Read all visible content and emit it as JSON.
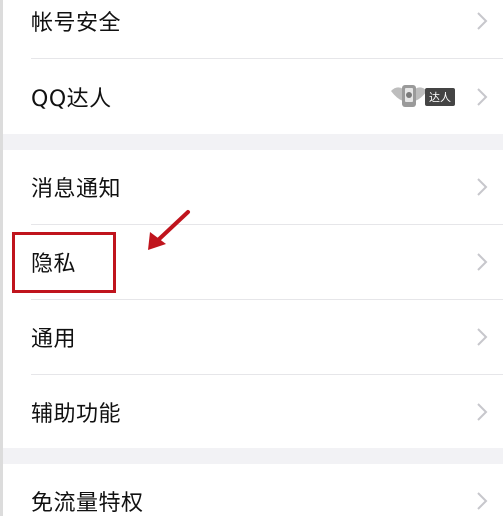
{
  "settings": {
    "items": [
      {
        "label": "帐号安全"
      },
      {
        "label": "QQ达人"
      },
      {
        "label": "消息通知"
      },
      {
        "label": "隐私"
      },
      {
        "label": "通用"
      },
      {
        "label": "辅助功能"
      },
      {
        "label": "免流量特权"
      }
    ],
    "qq_daren_badge": "达人"
  },
  "colors": {
    "highlight": "#c0141d",
    "background": "#f2f2f5",
    "row_background": "#ffffff",
    "chevron": "#c7c7cc"
  },
  "icons": {
    "chevron": "chevron-right-icon",
    "badge": "qq-daren-badge-icon",
    "arrow": "annotation-arrow-icon"
  }
}
